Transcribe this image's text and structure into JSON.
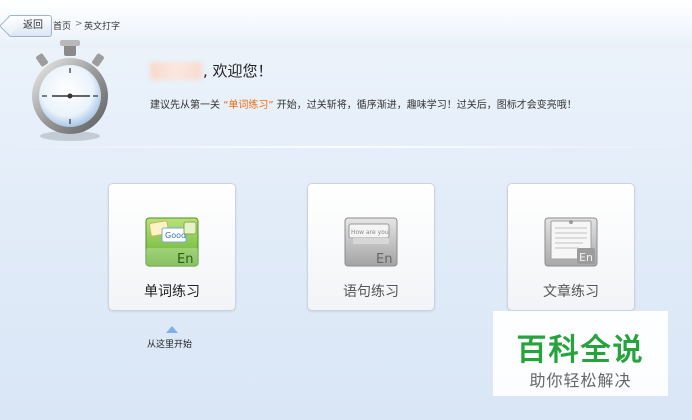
{
  "nav": {
    "back_label": "返回",
    "breadcrumb": [
      "首页",
      ">",
      "英文打字"
    ]
  },
  "welcome": {
    "greeting": ", 欢迎您！",
    "suggest_prefix": "建议先从第一关",
    "suggest_highlight": "“单词练习”",
    "suggest_suffix": "开始，过关斩将，循序渐进，趣味学习！过关后，图标才会变亮哦！"
  },
  "cards": [
    {
      "label": "单词练习",
      "icon": "word-practice-icon",
      "enabled": true,
      "icon_text": "En",
      "tag_text": "Good"
    },
    {
      "label": "语句练习",
      "icon": "sentence-practice-icon",
      "enabled": false,
      "icon_text": "En",
      "tag_text": "How are you"
    },
    {
      "label": "文章练习",
      "icon": "article-practice-icon",
      "enabled": false,
      "icon_text": "En"
    }
  ],
  "hint": {
    "text": "从这里开始"
  },
  "watermark": {
    "title": "百科全说",
    "subtitle": "助你轻松解决"
  },
  "colors": {
    "highlight": "#f06a10",
    "enabled_label": "#222222",
    "disabled_label": "#555555",
    "watermark": "#27a33d"
  }
}
